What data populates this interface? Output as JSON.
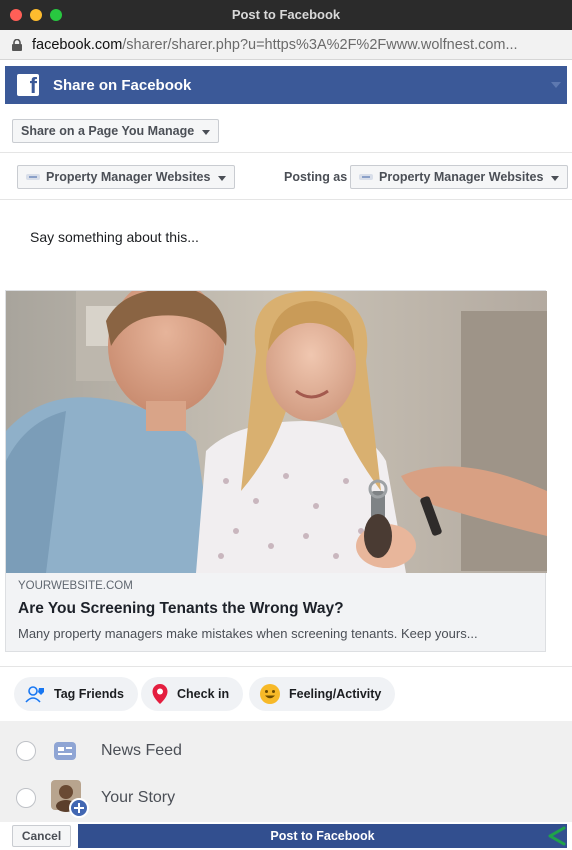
{
  "window": {
    "title": "Post to Facebook"
  },
  "url": {
    "host": "facebook.com",
    "path": "/sharer/sharer.php?u=https%3A%2F%2Fwww.wolfnest.com..."
  },
  "header": {
    "logo": "f",
    "title": "Share on Facebook"
  },
  "share_target": {
    "selected": "Share on a Page You Manage"
  },
  "page_select": {
    "selected": "Property Manager Websites"
  },
  "posting_as": {
    "label": "Posting as",
    "selected": "Property Manager Websites"
  },
  "composer": {
    "placeholder": "Say something about this..."
  },
  "preview": {
    "domain": "YOURWEBSITE.COM",
    "title": "Are You Screening Tenants the Wrong Way?",
    "description": "Many property managers make mistakes when screening tenants. Keep yours..."
  },
  "actions": [
    {
      "label": "Tag Friends",
      "icon": "tag-friends-icon"
    },
    {
      "label": "Check in",
      "icon": "location-pin-icon"
    },
    {
      "label": "Feeling/Activity",
      "icon": "smiley-icon"
    }
  ],
  "audience": [
    {
      "label": "News Feed",
      "icon": "news-feed-icon"
    },
    {
      "label": "Your Story",
      "icon": "story-avatar-icon"
    }
  ],
  "footer": {
    "cancel_label": "Cancel",
    "post_label": "Post to Facebook"
  },
  "colors": {
    "brand": "#3b5998",
    "post_button": "#324f8f",
    "pin": "#e41e3f",
    "feeling": "#f7b928"
  }
}
